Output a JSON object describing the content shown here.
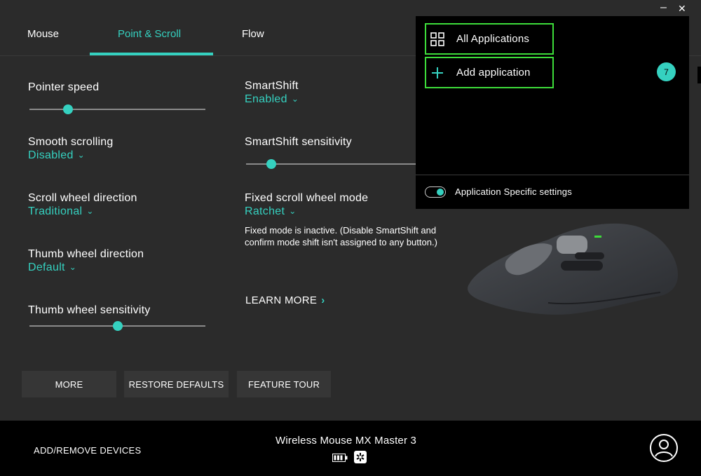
{
  "window": {
    "minimize_glyph": "‒",
    "close_glyph": "✕"
  },
  "tabs": [
    {
      "label": "Mouse",
      "active": false
    },
    {
      "label": "Point & Scroll",
      "active": true
    },
    {
      "label": "Flow",
      "active": false
    }
  ],
  "accent_color": "#35d1c0",
  "highlight_color": "#3ddc3a",
  "settings": {
    "pointer_speed": {
      "label": "Pointer speed",
      "value_fraction": 0.22
    },
    "smooth_scrolling": {
      "label": "Smooth scrolling",
      "value": "Disabled"
    },
    "scroll_wheel_direction": {
      "label": "Scroll wheel direction",
      "value": "Traditional"
    },
    "thumb_wheel_direction": {
      "label": "Thumb wheel direction",
      "value": "Default"
    },
    "thumb_wheel_sensitivity": {
      "label": "Thumb wheel sensitivity",
      "value_fraction": 0.5
    },
    "smartshift": {
      "label": "SmartShift",
      "value": "Enabled"
    },
    "smartshift_sensitivity": {
      "label": "SmartShift sensitivity",
      "value_fraction": 0.15
    },
    "fixed_scroll_wheel_mode": {
      "label": "Fixed scroll wheel mode",
      "value": "Ratchet"
    },
    "fixed_mode_note": "Fixed mode is inactive. (Disable SmartShift and confirm mode shift isn't assigned to any button.)",
    "learn_more": "LEARN MORE",
    "learn_more_arrow": "›"
  },
  "buttons": {
    "more": "MORE",
    "restore_defaults": "RESTORE DEFAULTS",
    "feature_tour": "FEATURE TOUR"
  },
  "footer": {
    "add_remove": "ADD/REMOVE DEVICES",
    "device_name": "Wireless Mouse MX Master 3"
  },
  "popover": {
    "all_applications": "All Applications",
    "add_application": "Add application",
    "badge_count": "7",
    "toggle_label": "Application Specific settings",
    "toggle_on": true
  }
}
